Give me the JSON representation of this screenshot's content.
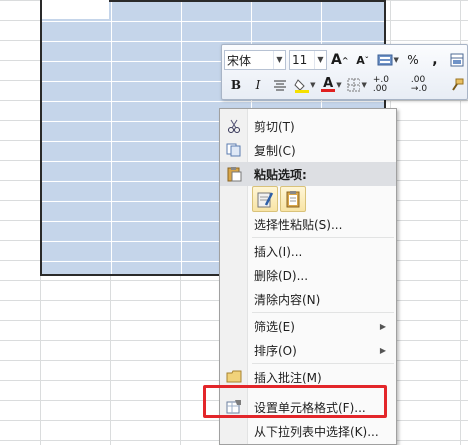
{
  "mini_toolbar": {
    "font_name": "宋体",
    "font_size": "11",
    "percent_symbol": "%",
    "comma_symbol": ",",
    "bold_label": "B",
    "italic_label": "I",
    "grow_font_label": "A",
    "shrink_font_label": "A",
    "font_color_label": "A",
    "font_color": "#e02020",
    "fill_color": "#f5e000",
    "increase_decimal_label": "+.0 .00",
    "decrease_decimal_label": ".00 →.0"
  },
  "context_menu": {
    "items": [
      {
        "label": "剪切(T)",
        "icon": "scissors-icon"
      },
      {
        "label": "复制(C)",
        "icon": "copy-icon"
      },
      {
        "label": "粘贴选项:",
        "icon": "paste-icon"
      },
      {
        "label": "选择性粘贴(S)..."
      },
      {
        "label": "插入(I)..."
      },
      {
        "label": "删除(D)..."
      },
      {
        "label": "清除内容(N)"
      },
      {
        "label": "筛选(E)",
        "submenu": "▶"
      },
      {
        "label": "排序(O)",
        "submenu": "▶"
      },
      {
        "label": "插入批注(M)",
        "icon": "comment-icon"
      },
      {
        "label": "设置单元格格式(F)...",
        "icon": "format-cells-icon"
      },
      {
        "label": "从下拉列表中选择(K)..."
      }
    ]
  },
  "highlight_color": "#e3262a"
}
